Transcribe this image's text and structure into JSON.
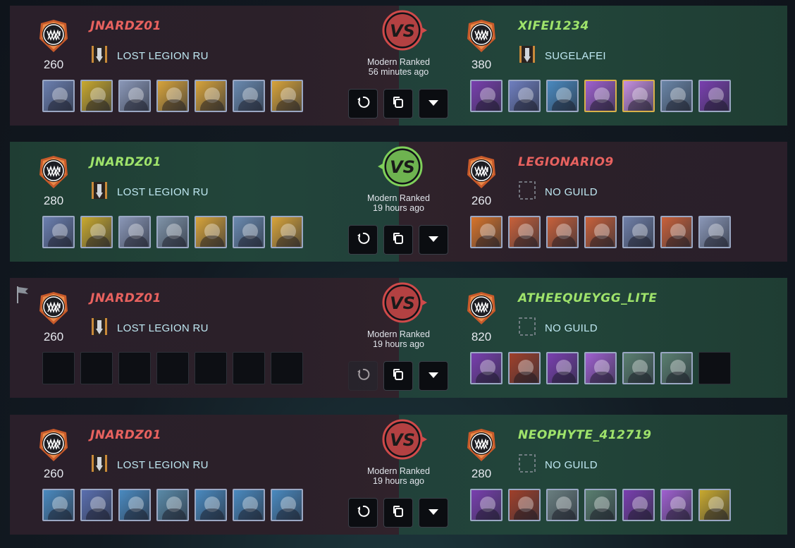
{
  "battles": [
    {
      "left": {
        "name": "JNARDZ01",
        "rating": "260",
        "guild": "LOST LEGION RU",
        "result": "lose"
      },
      "right": {
        "name": "XIFEI1234",
        "rating": "380",
        "guild": "SUGELAFEI",
        "result": "win"
      },
      "mode": "Modern Ranked",
      "time": "56 minutes ago",
      "winner": "right",
      "left_cards": [
        "#6b7fb0",
        "#c9a92e",
        "#8a97b7",
        "#d8a43a",
        "#d8a43a",
        "#6a8ab0",
        "#d8a43a"
      ],
      "right_cards": [
        "#7a3fb0",
        "#6f7fc0",
        "#4a8ac0",
        "#a060d0",
        "#c68fe0",
        "#6a86a8",
        "#7a3fb0"
      ]
    },
    {
      "left": {
        "name": "JNARDZ01",
        "rating": "280",
        "guild": "LOST LEGION RU",
        "result": "win"
      },
      "right": {
        "name": "LEGIONARIO9",
        "rating": "260",
        "guild": "NO GUILD",
        "result": "lose"
      },
      "mode": "Modern Ranked",
      "time": "19 hours ago",
      "winner": "left",
      "left_cards": [
        "#6b7fb0",
        "#c9a92e",
        "#8a97b7",
        "#7f93a8",
        "#d8a43a",
        "#6a8ab0",
        "#d8a43a"
      ],
      "right_cards": [
        "#d8742a",
        "#c9613a",
        "#c9613a",
        "#c9613a",
        "#6f7fa8",
        "#c9613a",
        "#8a97b7"
      ]
    },
    {
      "left": {
        "name": "JNARDZ01",
        "rating": "260",
        "guild": "LOST LEGION RU",
        "result": "lose"
      },
      "right": {
        "name": "ATHEEQUEYGG_LITE",
        "rating": "820",
        "guild": "NO GUILD",
        "result": "win"
      },
      "mode": "Modern Ranked",
      "time": "19 hours ago",
      "winner": "right",
      "flag": true,
      "left_cards": [],
      "right_cards": [
        "#7a3fb0",
        "#a0402a",
        "#7a3fb0",
        "#a060d0",
        "#5a7f70",
        "#5a7f70",
        "empty"
      ]
    },
    {
      "left": {
        "name": "JNARDZ01",
        "rating": "260",
        "guild": "LOST LEGION RU",
        "result": "lose"
      },
      "right": {
        "name": "NEOPHYTE_412719",
        "rating": "280",
        "guild": "NO GUILD",
        "result": "win"
      },
      "mode": "Modern Ranked",
      "time": "19 hours ago",
      "winner": "right",
      "left_cards": [
        "#4a8ac0",
        "#5a6fb0",
        "#4a8ac0",
        "#5a8aa8",
        "#4a8ac0",
        "#4a8ac0",
        "#4a8ac0"
      ],
      "right_cards": [
        "#7a3fb0",
        "#a0402a",
        "#6a7f80",
        "#5a7f70",
        "#7a3fb0",
        "#a060d0",
        "#c9a92e"
      ]
    }
  ],
  "colors": {
    "lose": "#e8625f",
    "win": "#9fe36b",
    "vs_lose": "#d04a4a",
    "vs_win": "#7fd05a",
    "badge": "#e07a3a"
  },
  "icons": {
    "badge": "monster-mouth-icon",
    "rematch": "replay-icon",
    "copy": "copy-icon",
    "expand": "caret-down-icon",
    "flag": "surrender-flag-icon",
    "guild": "guild-banner-icon",
    "no_guild": "empty-guild-icon"
  },
  "vs_label": "VS"
}
